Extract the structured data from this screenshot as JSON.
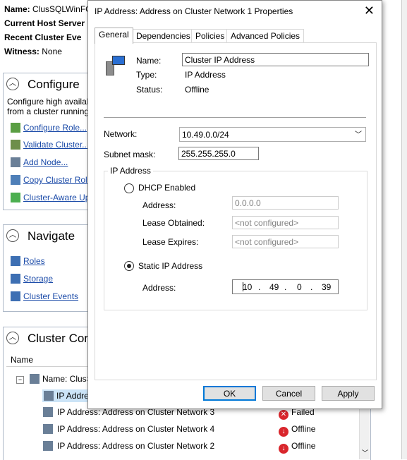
{
  "background": {
    "summary": {
      "name_label": "Name:",
      "name_value": "ClusSQLWinFC",
      "current_host_label": "Current Host Server",
      "recent_events_label": "Recent Cluster Eve",
      "witness_label": "Witness:",
      "witness_value": "None"
    },
    "configure": {
      "title": "Configure",
      "description_line1": "Configure high availab",
      "description_line2": "from a cluster running",
      "actions": [
        "Configure Role...",
        "Validate Cluster...",
        "Add Node...",
        "Copy Cluster Roles",
        "Cluster-Aware Upd"
      ]
    },
    "navigate": {
      "title": "Navigate",
      "links": [
        "Roles",
        "Storage",
        "Cluster Events"
      ]
    },
    "cluster_core": {
      "title": "Cluster Cor",
      "column_name": "Name",
      "tree_root": "Name: ClusS",
      "selected_row": "IP Addre",
      "rows": [
        {
          "name": "IP Address: Address on Cluster Network 3",
          "status": "Failed"
        },
        {
          "name": "IP Address: Address on Cluster Network 4",
          "status": "Offline"
        },
        {
          "name": "IP Address: Address on Cluster Network 2",
          "status": "Offline"
        }
      ]
    }
  },
  "dialog": {
    "title": "IP Address: Address on Cluster Network 1 Properties",
    "tabs": [
      "General",
      "Dependencies",
      "Policies",
      "Advanced Policies"
    ],
    "name_label": "Name:",
    "name_value": "Cluster IP Address",
    "type_label": "Type:",
    "type_value": "IP Address",
    "status_label": "Status:",
    "status_value": "Offline",
    "network_label": "Network:",
    "network_value": "10.49.0.0/24",
    "subnet_label": "Subnet mask:",
    "subnet_value": "255.255.255.0",
    "ip_group_caption": "IP Address",
    "dhcp_label": "DHCP Enabled",
    "dhcp_address_label": "Address:",
    "dhcp_address_value": "0.0.0.0",
    "lease_obtained_label": "Lease Obtained:",
    "lease_obtained_value": "<not configured>",
    "lease_expires_label": "Lease Expires:",
    "lease_expires_value": "<not configured>",
    "static_label": "Static IP Address",
    "static_address_label": "Address:",
    "static_octets": [
      "10",
      "49",
      "0",
      "39"
    ],
    "ok_label": "OK",
    "cancel_label": "Cancel",
    "apply_label": "Apply"
  },
  "colors": {
    "accent": "#0078d7",
    "failed": "#d9262c",
    "offline": "#d9262c",
    "link": "#1a4aa8"
  }
}
